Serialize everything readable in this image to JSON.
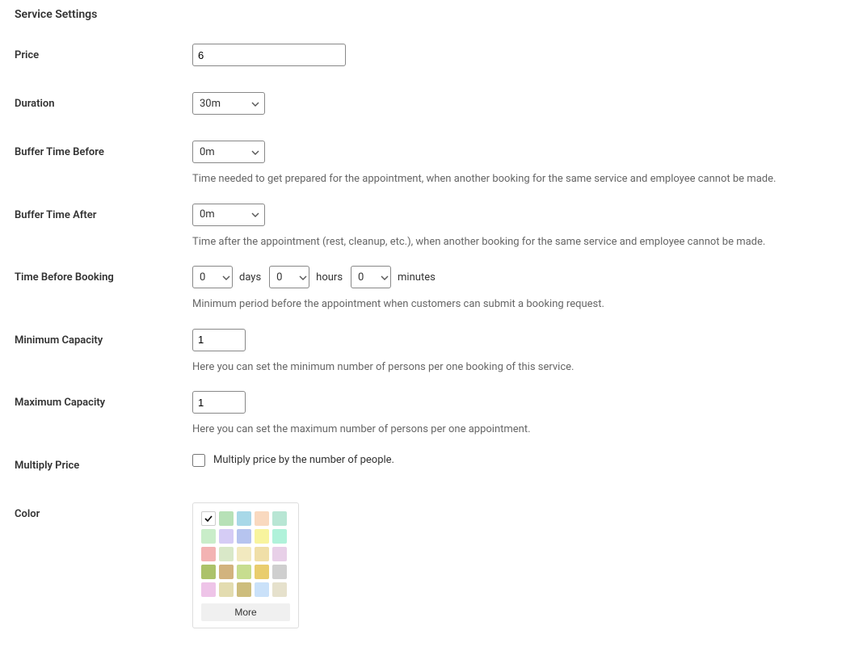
{
  "section_title": "Service Settings",
  "price": {
    "label": "Price",
    "value": "6"
  },
  "duration": {
    "label": "Duration",
    "value": "30m"
  },
  "buffer_before": {
    "label": "Buffer Time Before",
    "value": "0m",
    "description": "Time needed to get prepared for the appointment, when another booking for the same service and employee cannot be made."
  },
  "buffer_after": {
    "label": "Buffer Time After",
    "value": "0m",
    "description": "Time after the appointment (rest, cleanup, etc.), when another booking for the same service and employee cannot be made."
  },
  "time_before_booking": {
    "label": "Time Before Booking",
    "days": "0",
    "hours": "0",
    "minutes": "0",
    "days_label": "days",
    "hours_label": "hours",
    "minutes_label": "minutes",
    "description": "Minimum period before the appointment when customers can submit a booking request."
  },
  "min_capacity": {
    "label": "Minimum Capacity",
    "value": "1",
    "description": "Here you can set the minimum number of persons per one booking of this service."
  },
  "max_capacity": {
    "label": "Maximum Capacity",
    "value": "1",
    "description": "Here you can set the maximum number of persons per one appointment."
  },
  "multiply_price": {
    "label": "Multiply Price",
    "checkbox_label": "Multiply price by the number of people."
  },
  "color": {
    "label": "Color",
    "more_label": "More",
    "swatches": [
      {
        "hex": "#ffffff",
        "selected": true,
        "border": true
      },
      {
        "hex": "#b7e1b7"
      },
      {
        "hex": "#a8d8e8"
      },
      {
        "hex": "#f9d9bf"
      },
      {
        "hex": "#b8e6d4"
      },
      {
        "hex": "#c9edc9"
      },
      {
        "hex": "#d5ccf5"
      },
      {
        "hex": "#b6c4ef"
      },
      {
        "hex": "#f8f49e"
      },
      {
        "hex": "#b0f2da"
      },
      {
        "hex": "#f3b3b3"
      },
      {
        "hex": "#d9e8c8"
      },
      {
        "hex": "#f2e9bf"
      },
      {
        "hex": "#f0dfa8"
      },
      {
        "hex": "#e8d0e8"
      },
      {
        "hex": "#acc26a"
      },
      {
        "hex": "#d2b37e"
      },
      {
        "hex": "#c7dd8f"
      },
      {
        "hex": "#e9cd6e"
      },
      {
        "hex": "#cfcfcf"
      },
      {
        "hex": "#eec4e8"
      },
      {
        "hex": "#e3dcb0"
      },
      {
        "hex": "#cdbd7d"
      },
      {
        "hex": "#cae1f9"
      },
      {
        "hex": "#e6e1cc"
      }
    ]
  }
}
